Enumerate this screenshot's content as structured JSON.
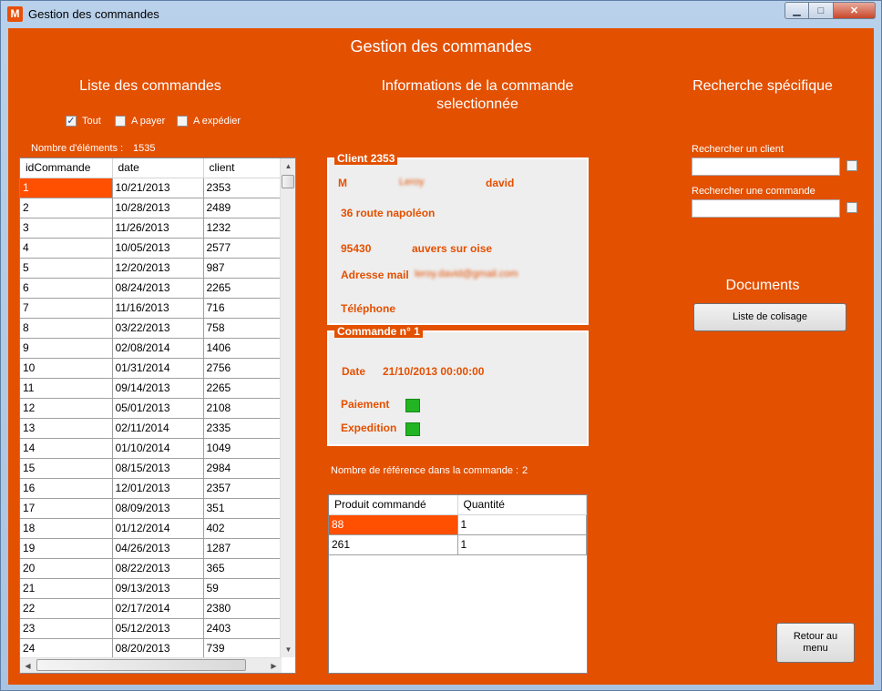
{
  "window": {
    "title": "Gestion des commandes",
    "app_icon_letter": "M"
  },
  "header": {
    "title": "Gestion des commandes"
  },
  "left": {
    "heading": "Liste des commandes",
    "filters": [
      {
        "label": "Tout",
        "checked": true
      },
      {
        "label": "A payer",
        "checked": false
      },
      {
        "label": "A expédier",
        "checked": false
      }
    ],
    "count_label": "Nombre d'éléments :",
    "count_value": "1535",
    "columns": [
      "idCommande",
      "date",
      "client"
    ],
    "rows": [
      [
        "1",
        "10/21/2013",
        "2353"
      ],
      [
        "2",
        "10/28/2013",
        "2489"
      ],
      [
        "3",
        "11/26/2013",
        "1232"
      ],
      [
        "4",
        "10/05/2013",
        "2577"
      ],
      [
        "5",
        "12/20/2013",
        "987"
      ],
      [
        "6",
        "08/24/2013",
        "2265"
      ],
      [
        "7",
        "11/16/2013",
        "716"
      ],
      [
        "8",
        "03/22/2013",
        "758"
      ],
      [
        "9",
        "02/08/2014",
        "1406"
      ],
      [
        "10",
        "01/31/2014",
        "2756"
      ],
      [
        "11",
        "09/14/2013",
        "2265"
      ],
      [
        "12",
        "05/01/2013",
        "2108"
      ],
      [
        "13",
        "02/11/2014",
        "2335"
      ],
      [
        "14",
        "01/10/2014",
        "1049"
      ],
      [
        "15",
        "08/15/2013",
        "2984"
      ],
      [
        "16",
        "12/01/2013",
        "2357"
      ],
      [
        "17",
        "08/09/2013",
        "351"
      ],
      [
        "18",
        "01/12/2014",
        "402"
      ],
      [
        "19",
        "04/26/2013",
        "1287"
      ],
      [
        "20",
        "08/22/2013",
        "365"
      ],
      [
        "21",
        "09/13/2013",
        "59"
      ],
      [
        "22",
        "02/17/2014",
        "2380"
      ],
      [
        "23",
        "05/12/2013",
        "2403"
      ],
      [
        "24",
        "08/20/2013",
        "739"
      ]
    ]
  },
  "middle": {
    "heading": "Informations de la commande selectionnée",
    "client_group": {
      "title": "Client",
      "id": "2353",
      "civility": "M",
      "last_name": "Leroy",
      "first_name": "david",
      "address": "36 route napoléon",
      "postal_code": "95430",
      "city": "auvers sur oise",
      "email_label": "Adresse mail",
      "email": "leroy.david@gmail.com",
      "phone_label": "Téléphone"
    },
    "order_group": {
      "title": "Commande n°",
      "id": "1",
      "date_label": "Date",
      "date_value": "21/10/2013 00:00:00",
      "payment_label": "Paiement",
      "shipping_label": "Expedition",
      "status_color": "#22b422"
    },
    "ref_count_label": "Nombre de référence dans la commande :",
    "ref_count_value": "2",
    "columns": [
      "Produit commandé",
      "Quantité"
    ],
    "rows": [
      [
        "88",
        "1"
      ],
      [
        "261",
        "1"
      ]
    ]
  },
  "right": {
    "heading": "Recherche spécifique",
    "client_search_label": "Rechercher un client",
    "order_search_label": "Rechercher une commande",
    "documents_heading": "Documents",
    "packing_list_button": "Liste de colisage",
    "back_button": "Retour au menu"
  },
  "colors": {
    "background": "#e35000",
    "selection": "#ff4f00",
    "group_bg": "#eeeeee"
  }
}
